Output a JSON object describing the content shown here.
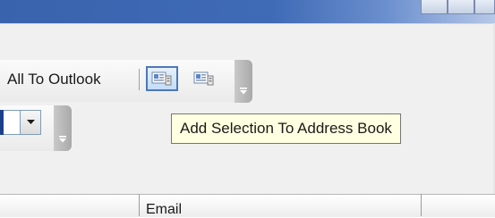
{
  "toolbar": {
    "add_all_label": "All To Outlook",
    "add_selection_button_icon": "contact-card-icon",
    "secondary_button_icon": "contact-card-icon"
  },
  "tooltip": {
    "text": "Add Selection To Address Book"
  },
  "grid": {
    "columns": [
      "",
      "Email",
      ""
    ]
  },
  "colors": {
    "titlebar": "#3f6ab6",
    "tooltip_bg": "#ffffe1",
    "selected_border": "#4d78b6"
  }
}
